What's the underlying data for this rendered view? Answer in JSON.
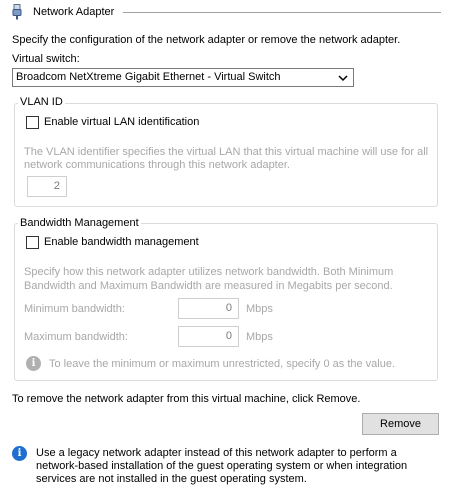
{
  "header": {
    "title": "Network Adapter",
    "icon": "network-adapter-icon"
  },
  "intro": "Specify the configuration of the network adapter or remove the network adapter.",
  "virtual_switch": {
    "label": "Virtual switch:",
    "selected": "Broadcom NetXtreme Gigabit Ethernet - Virtual Switch"
  },
  "vlan": {
    "legend": "VLAN ID",
    "checkbox_label": "Enable virtual LAN identification",
    "desc_line1": "The VLAN identifier specifies the virtual LAN that this virtual machine will use for all",
    "desc_line2": "network communications through this network adapter.",
    "value": "2"
  },
  "bandwidth": {
    "legend": "Bandwidth Management",
    "checkbox_label": "Enable bandwidth management",
    "desc_line1": "Specify how this network adapter utilizes network bandwidth. Both Minimum",
    "desc_line2": "Bandwidth and Maximum Bandwidth are measured in Megabits per second.",
    "min_label": "Minimum bandwidth:",
    "min_value": "0",
    "max_label": "Maximum bandwidth:",
    "max_value": "0",
    "unit": "Mbps",
    "unit2": "Mbps",
    "info_text": "To leave the minimum or maximum unrestricted, specify 0 as the value."
  },
  "remove": {
    "instruction": "To remove the network adapter from this virtual machine, click Remove.",
    "button_label": "Remove"
  },
  "legacy_info": {
    "line1": "Use a legacy network adapter instead of this network adapter to perform a",
    "line2": "network-based installation of the guest operating system or when integration",
    "line3": "services are not installed in the guest operating system."
  },
  "colors": {
    "info_blue": "#1f6fd0",
    "info_gray": "#a8a8a8"
  }
}
